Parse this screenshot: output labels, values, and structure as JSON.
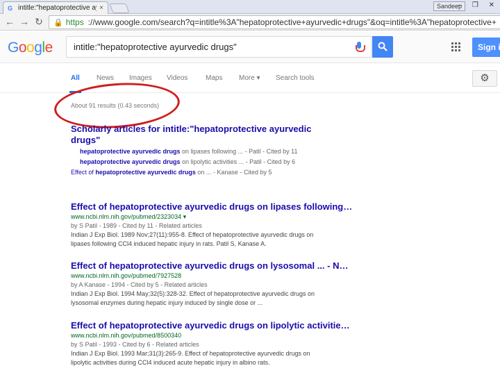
{
  "browser": {
    "tab_title": "intitle:\"hepatoprotective ay...",
    "tab_close": "×",
    "profile": "Sandeep",
    "window_controls": "– ❐ ✕",
    "url_scheme": "https",
    "url_rest": "://www.google.com/search?q=intitle%3A\"hepatoprotective+ayurvedic+drugs\"&oq=intitle%3A\"hepatoprotective+"
  },
  "google": {
    "logo_letters": [
      "G",
      "o",
      "o",
      "g",
      "l",
      "e"
    ],
    "logo_colors": [
      "#4285f4",
      "#ea4335",
      "#fbbc05",
      "#4285f4",
      "#34a853",
      "#ea4335"
    ],
    "query": "intitle:\"hepatoprotective ayurvedic drugs\"",
    "signin_label": "Sign in",
    "tabs": [
      "All",
      "News",
      "Images",
      "Videos",
      "Maps",
      "More ▾",
      "Search tools"
    ],
    "stats": "About 91 results (0.43 seconds)"
  },
  "results": {
    "scholar": {
      "title_line1": "Scholarly articles for intitle:\"hepatoprotective ayurvedic",
      "title_line2": "drugs\"",
      "items": [
        {
          "title": "hepatoprotective ayurvedic drugs",
          "rest": " on lipases following ... - Patil - Cited by 11",
          "indent": true
        },
        {
          "title": "hepatoprotective ayurvedic drugs",
          "rest": " on lipolytic activities ... - Patil - Cited by 6",
          "indent": true
        },
        {
          "lead": "Effect of ",
          "title": "hepatoprotective ayurvedic drugs",
          "rest": " on ... - Kanase - Cited by 5",
          "indent": false
        }
      ]
    },
    "items": [
      {
        "title": "Effect of hepatoprotective ayurvedic drugs on lipases following…",
        "cite": "www.ncbi.nlm.nih.gov/pubmed/2323034 ▾",
        "meta": "by S Patil - 1989 - Cited by 11 - Related articles",
        "snippet1": "Indian J Exp Biol. 1989 Nov;27(11):955-8. Effect of hepatoprotective ayurvedic drugs on",
        "snippet2": "lipases following CCl4 induced hepatic injury in rats. Patil S, Kanase A."
      },
      {
        "title": "Effect of hepatoprotective ayurvedic drugs on lysosomal ... - N…",
        "cite": "www.ncbi.nlm.nih.gov/pubmed/7927528",
        "meta": "by A Kanase - 1994 - Cited by 5 - Related articles",
        "snippet1": "Indian J Exp Biol. 1994 May;32(5):328-32. Effect of hepatoprotective ayurvedic drugs on",
        "snippet2": "lysosomal enzymes during hepatic injury induced by single dose or ..."
      },
      {
        "title": "Effect of hepatoprotective ayurvedic drugs on lipolytic activitie…",
        "cite": "www.ncbi.nlm.nih.gov/pubmed/8500340",
        "meta": "by S Patil - 1993 - Cited by 6 - Related articles",
        "snippet1": "Indian J Exp Biol. 1993 Mar;31(3):265-9. Effect of hepatoprotective ayurvedic drugs on",
        "snippet2": "lipolytic activities during CCl4 induced acute hepatic injury in albino rats."
      }
    ]
  }
}
